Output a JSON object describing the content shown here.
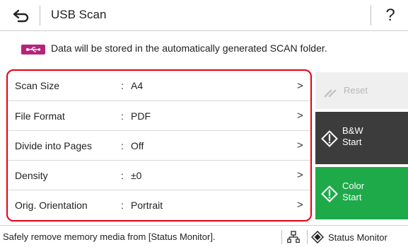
{
  "header": {
    "title": "USB Scan",
    "help_label": "?"
  },
  "info": {
    "message": "Data will be stored in the automatically generated SCAN folder."
  },
  "settings": {
    "rows": [
      {
        "label": "Scan Size",
        "colon": ":",
        "value": "A4",
        "chevron": ">"
      },
      {
        "label": "File Format",
        "colon": ":",
        "value": "PDF",
        "chevron": ">"
      },
      {
        "label": "Divide into Pages",
        "colon": ":",
        "value": "Off",
        "chevron": ">"
      },
      {
        "label": "Density",
        "colon": ":",
        "value": "±0",
        "chevron": ">"
      },
      {
        "label": "Orig. Orientation",
        "colon": ":",
        "value": "Portrait",
        "chevron": ">"
      }
    ]
  },
  "actions": {
    "reset_label": "Reset",
    "bw_label_line1": "B&W",
    "bw_label_line2": "Start",
    "color_label_line1": "Color",
    "color_label_line2": "Start"
  },
  "status_bar": {
    "message": "Safely remove memory media from [Status Monitor].",
    "status_monitor_label": "Status Monitor"
  },
  "colors": {
    "highlight_border": "#e60012",
    "usb_badge": "#b4257a",
    "bw_button": "#3c3c3c",
    "color_button": "#1faa4a",
    "reset_button": "#efefef"
  },
  "icons": {
    "back": "back-arrow-icon",
    "usb": "usb-icon",
    "reset": "reset-icon",
    "start": "start-icon",
    "network": "network-icon",
    "status_monitor": "status-monitor-icon"
  }
}
